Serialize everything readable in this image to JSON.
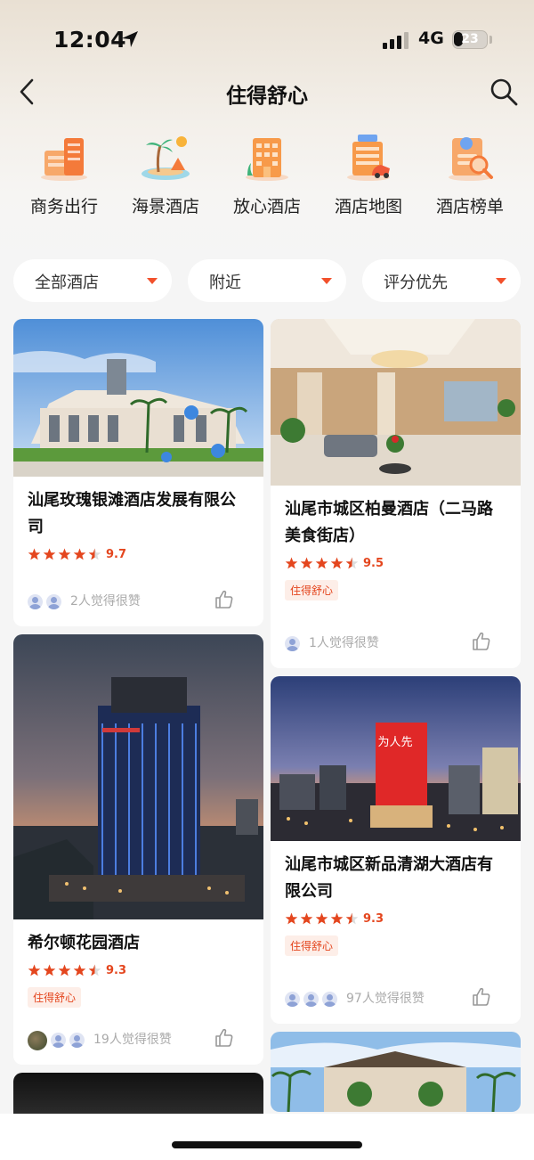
{
  "status_bar": {
    "time": "12:04",
    "network": "4G",
    "battery": "23"
  },
  "nav": {
    "title": "住得舒心"
  },
  "categories": [
    {
      "label": "商务出行",
      "icon": "business-building-icon"
    },
    {
      "label": "海景酒店",
      "icon": "beach-palm-icon"
    },
    {
      "label": "放心酒店",
      "icon": "hotel-building-icon"
    },
    {
      "label": "酒店地图",
      "icon": "hotel-map-icon"
    },
    {
      "label": "酒店榜单",
      "icon": "ranking-list-icon"
    }
  ],
  "filters": [
    {
      "label": "全部酒店"
    },
    {
      "label": "附近"
    },
    {
      "label": "评分优先"
    }
  ],
  "hotels_left": [
    {
      "name": "汕尾玫瑰银滩酒店发展有限公司",
      "rating": 4.5,
      "score": "9.7",
      "tag": "",
      "likes": "2人觉得很赞"
    },
    {
      "name": "希尔顿花园酒店",
      "rating": 4.5,
      "score": "9.3",
      "tag": "住得舒心",
      "likes": "19人觉得很赞"
    }
  ],
  "hotels_right": [
    {
      "name": "汕尾市城区柏曼酒店（二马路美食街店）",
      "rating": 4.5,
      "score": "9.5",
      "tag": "住得舒心",
      "likes": "1人觉得很赞"
    },
    {
      "name": "汕尾市城区新品清湖大酒店有限公司",
      "rating": 4.5,
      "score": "9.3",
      "tag": "住得舒心",
      "likes": "97人觉得很赞"
    }
  ],
  "hotel_sign_text": "为人先",
  "colors": {
    "accent": "#e4461e",
    "tag_bg": "#fdeee8"
  }
}
